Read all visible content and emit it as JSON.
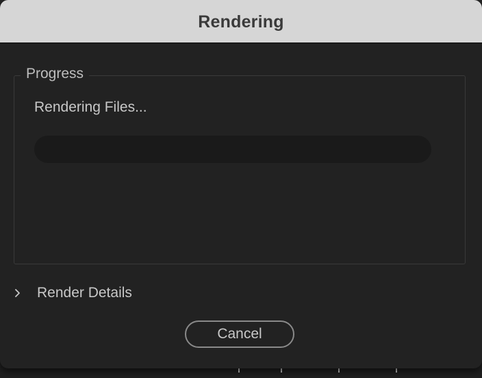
{
  "dialog": {
    "title": "Rendering",
    "progress_group": {
      "legend": "Progress",
      "status": "Rendering Files...",
      "progress_fraction": 0.0,
      "progress_color": "#2d8ceb"
    },
    "details": {
      "label": "Render Details",
      "expanded": false,
      "icon": "chevron-right-icon"
    },
    "cancel_label": "Cancel"
  }
}
